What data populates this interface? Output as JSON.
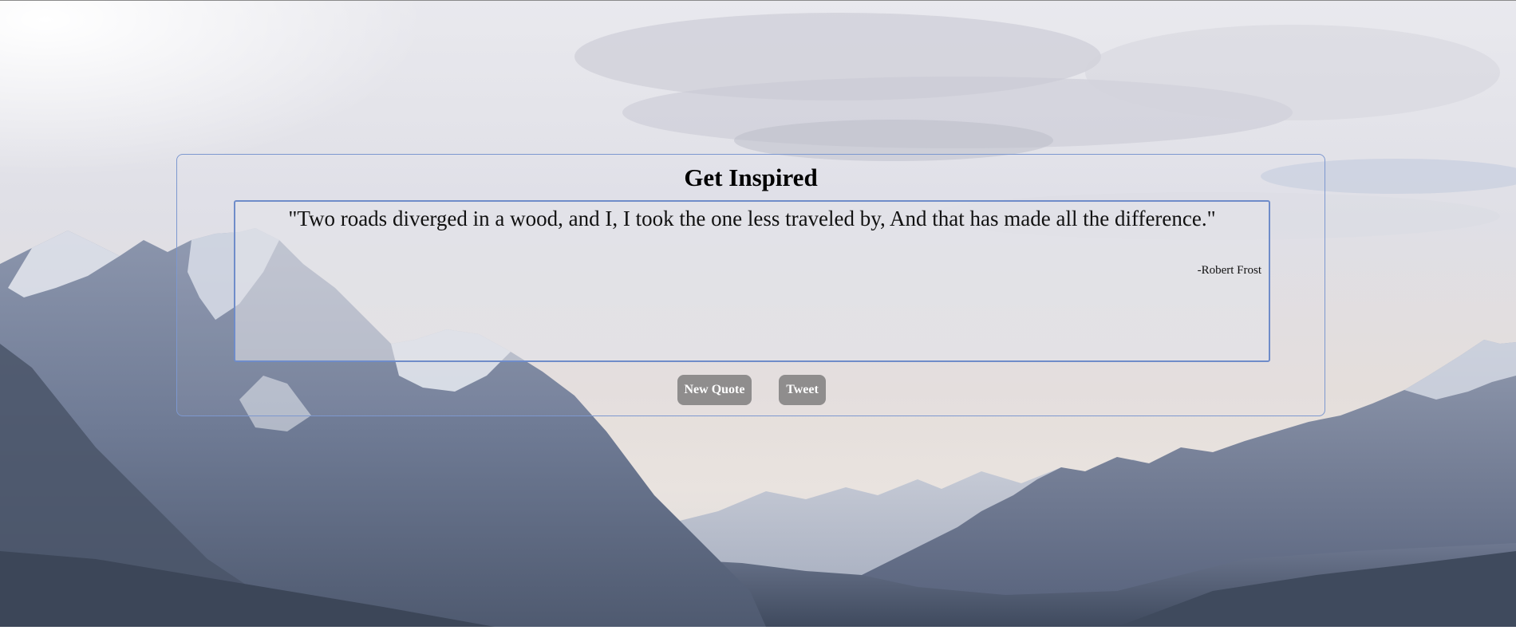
{
  "page": {
    "title": "Get Inspired"
  },
  "quote": {
    "text": "\"Two roads diverged in a wood, and I, I took the one less traveled by, And that has made all the difference.\"",
    "author": "-Robert Frost"
  },
  "buttons": {
    "new_quote_label": "New Quote",
    "tweet_label": "Tweet"
  },
  "colors": {
    "panel_border": "#7d98cf",
    "quote_border": "#6f8cc9",
    "button_bg": "#8f8d8d",
    "button_text": "#ffffff"
  },
  "background": {
    "description_icon": "mountain-landscape-image"
  }
}
